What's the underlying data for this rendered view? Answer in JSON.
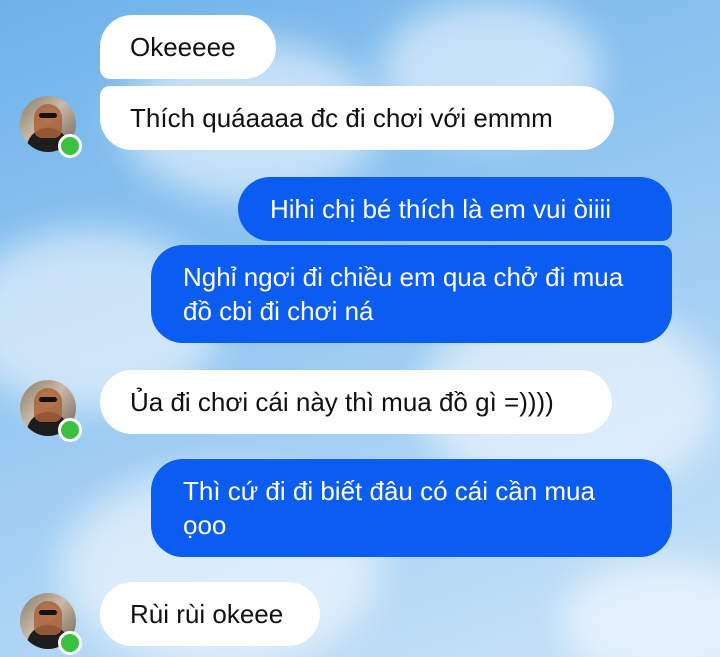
{
  "colors": {
    "outgoing_bubble": "#0b5cf0",
    "incoming_bubble": "#ffffff",
    "online_indicator": "#3ac13f"
  },
  "messages": [
    {
      "direction": "incoming",
      "text": "Okeeeee"
    },
    {
      "direction": "incoming",
      "text": "Thích quáaaaa đc đi chơi với emmm"
    },
    {
      "direction": "outgoing",
      "text": "Hihi chị bé thích là em vui òiiii"
    },
    {
      "direction": "outgoing",
      "text": "Nghỉ ngơi đi chiều em qua chở đi mua đồ cbi đi chơi ná"
    },
    {
      "direction": "incoming",
      "text": "Ủa đi chơi cái này thì mua đồ gì =))))"
    },
    {
      "direction": "outgoing",
      "text": "Thì cứ đi đi biết đâu có cái cần mua ọoo"
    },
    {
      "direction": "incoming",
      "text": "Rùi rùi okeee"
    }
  ]
}
